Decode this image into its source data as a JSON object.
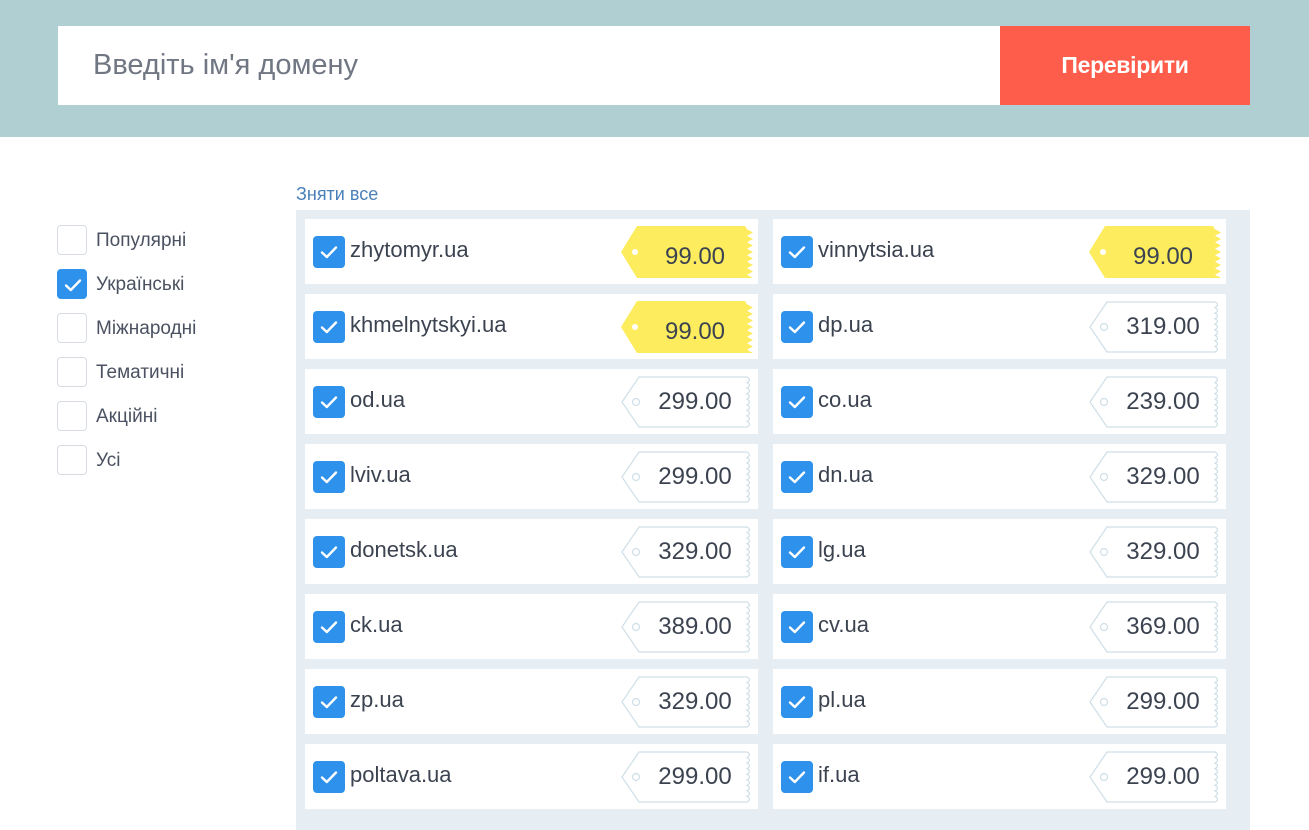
{
  "search": {
    "placeholder": "Введіть ім'я домену",
    "button_label": "Перевірити"
  },
  "colors": {
    "header_bg": "#afcfd3",
    "button_bg": "#ff5d4b",
    "accent_blue": "#2e92ec",
    "promo_tag": "#fcec5e",
    "panel_bg": "#e6edf3"
  },
  "filters": [
    {
      "label": "Популярні",
      "checked": false
    },
    {
      "label": "Українські",
      "checked": true
    },
    {
      "label": "Міжнародні",
      "checked": false
    },
    {
      "label": "Тематичні",
      "checked": false
    },
    {
      "label": "Акційні",
      "checked": false
    },
    {
      "label": "Усі",
      "checked": false
    }
  ],
  "clear_all_label": "Зняти все",
  "domains": [
    {
      "name": "zhytomyr.ua",
      "price": "99.00",
      "promo": true,
      "checked": true
    },
    {
      "name": "vinnytsia.ua",
      "price": "99.00",
      "promo": true,
      "checked": true
    },
    {
      "name": "khmelnytskyi.ua",
      "price": "99.00",
      "promo": true,
      "checked": true
    },
    {
      "name": "dp.ua",
      "price": "319.00",
      "promo": false,
      "checked": true
    },
    {
      "name": "od.ua",
      "price": "299.00",
      "promo": false,
      "checked": true
    },
    {
      "name": "co.ua",
      "price": "239.00",
      "promo": false,
      "checked": true
    },
    {
      "name": "lviv.ua",
      "price": "299.00",
      "promo": false,
      "checked": true
    },
    {
      "name": "dn.ua",
      "price": "329.00",
      "promo": false,
      "checked": true
    },
    {
      "name": "donetsk.ua",
      "price": "329.00",
      "promo": false,
      "checked": true
    },
    {
      "name": "lg.ua",
      "price": "329.00",
      "promo": false,
      "checked": true
    },
    {
      "name": "ck.ua",
      "price": "389.00",
      "promo": false,
      "checked": true
    },
    {
      "name": "cv.ua",
      "price": "369.00",
      "promo": false,
      "checked": true
    },
    {
      "name": "zp.ua",
      "price": "329.00",
      "promo": false,
      "checked": true
    },
    {
      "name": "pl.ua",
      "price": "299.00",
      "promo": false,
      "checked": true
    },
    {
      "name": "poltava.ua",
      "price": "299.00",
      "promo": false,
      "checked": true
    },
    {
      "name": "if.ua",
      "price": "299.00",
      "promo": false,
      "checked": true
    }
  ]
}
